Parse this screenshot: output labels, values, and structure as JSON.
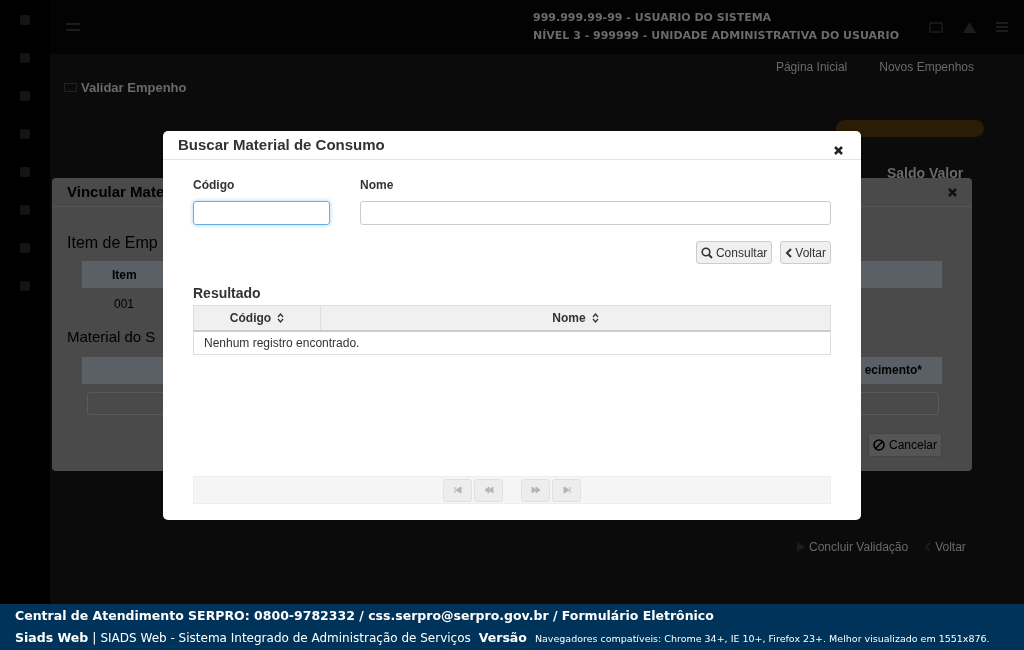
{
  "header": {
    "user": "999.999.99-99 - USUARIO DO SISTEMA",
    "unit": "NÍVEL 3 - 999999 - UNIDADE ADMINISTRATIVA DO USUARIO"
  },
  "breadcrumbs": [
    {
      "label": "Página Inicial"
    },
    {
      "label": "Novos Empenhos"
    }
  ],
  "page_title": "Validar Empenho",
  "balance_label": "Saldo Valor",
  "background_dialog": {
    "title": "Vincular Mate",
    "item_section": "Item de Emp",
    "item_column": "Item",
    "item_value": "001",
    "material_section": "Material do S",
    "material_column": "ecimento*",
    "cancel": "Cancelar"
  },
  "page_actions": [
    {
      "kind": "play",
      "label": "Concluir Validação"
    },
    {
      "kind": "back",
      "label": "Voltar"
    }
  ],
  "dialog": {
    "title": "Buscar Material de Consumo",
    "fields": [
      {
        "label": "Código",
        "focused": true
      },
      {
        "label": "Nome",
        "focused": false
      }
    ],
    "buttons": [
      {
        "kind": "search",
        "label": "Consultar"
      },
      {
        "kind": "back",
        "label": "Voltar"
      }
    ],
    "result_title": "Resultado",
    "columns": [
      "Código",
      "Nome"
    ],
    "empty_message": "Nenhum registro encontrado.",
    "pager": [
      {
        "kind": "first",
        "disabled": true
      },
      {
        "kind": "prev",
        "disabled": true
      },
      {
        "kind": "next",
        "disabled": true
      },
      {
        "kind": "last",
        "disabled": true
      }
    ]
  },
  "footer": {
    "contact": "Central de Atendimento SERPRO: 0800-9782332 / css.serpro@serpro.gov.br / Formulário Eletrônico",
    "app": "Siads Web",
    "separator": "|",
    "system": "SIADS Web - Sistema Integrado de Administração de Serviços",
    "version": "Versão",
    "browsers": "Navegadores compatíveis: Chrome 34+, IE 10+, Firefox 23+. Melhor visualizado em 1551x876."
  }
}
